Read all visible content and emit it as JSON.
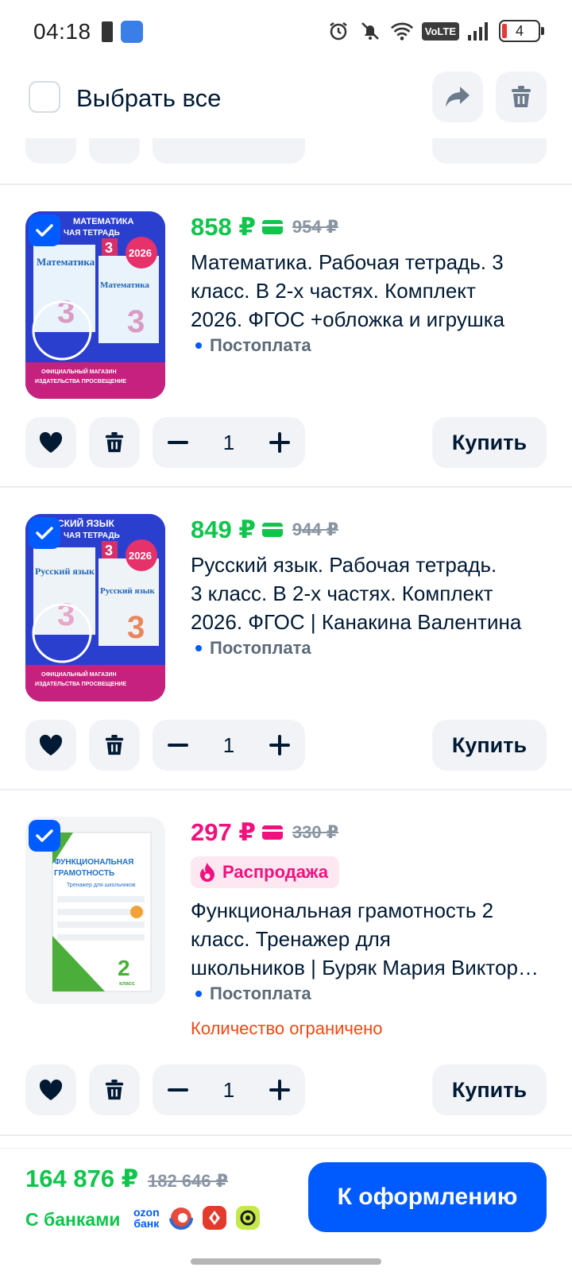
{
  "status_bar": {
    "time": "04:18",
    "volte": "VoLTE",
    "battery": "4"
  },
  "header": {
    "select_all": "Выбрать все"
  },
  "items": [
    {
      "price": "858 ₽",
      "old_price": "954 ₽",
      "price_color": "#10c44c",
      "title_lines": [
        "Математика. Рабочая тетрадь. 3",
        "класс. В 2-х частях. Комплект",
        "2026. ФГОС +обложка и игрушка"
      ],
      "payment": "Постоплата",
      "quantity": "1",
      "buy": "Купить",
      "cover": {
        "title": "Математика",
        "grade": "3",
        "year": "2026",
        "top_text": "МАТЕМАТИКА",
        "sub_text": "ЧАЯ ТЕТРАДЬ",
        "bottom_text": "ОФИЦИАЛЬНЫЙ МАГАЗИН",
        "bottom_text2": "ИЗДАТЕЛЬСТВА ПРОСВЕЩЕНИЕ"
      }
    },
    {
      "price": "849 ₽",
      "old_price": "944 ₽",
      "price_color": "#10c44c",
      "title_lines": [
        "Русский язык. Рабочая тетрадь.",
        "3 класс. В 2-х частях. Комплект",
        "2026. ФГОС | Канакина Валентина"
      ],
      "payment": "Постоплата",
      "quantity": "1",
      "buy": "Купить",
      "cover": {
        "title": "Русский язык",
        "grade": "3",
        "year": "2026",
        "top_text": "СКИЙ ЯЗЫК",
        "sub_text": "ЧАЯ ТЕТРАДЬ",
        "bottom_text": "ОФИЦИАЛЬНЫЙ МАГАЗИН",
        "bottom_text2": "ИЗДАТЕЛЬСТВА ПРОСВЕЩЕНИЕ"
      }
    },
    {
      "price": "297 ₽",
      "old_price": "330 ₽",
      "price_color": "#f1117e",
      "badge": "Распродажа",
      "title_lines": [
        "Функциональная грамотность 2",
        "класс. Тренажер для",
        "школьников | Буряк Мария Викторовна"
      ],
      "payment": "Постоплата",
      "limited": "Количество ограничено",
      "quantity": "1",
      "buy": "Купить",
      "cover": {
        "title": "ФУНКЦИОНАЛЬНАЯ ГРАМОТНОСТЬ",
        "subtitle": "Тренажер для школьников",
        "grade": "2",
        "grade_label": "класс"
      }
    }
  ],
  "summary": {
    "total": "164 876 ₽",
    "total_old": "182 646 ₽",
    "banks_label": "С банками",
    "ozon_bank_line1": "ozon",
    "ozon_bank_line2": "банк",
    "checkout": "К оформлению"
  },
  "colors": {
    "accent": "#005bff",
    "price_green": "#10c44c",
    "price_pink": "#f1117e",
    "warning": "#f24814"
  }
}
